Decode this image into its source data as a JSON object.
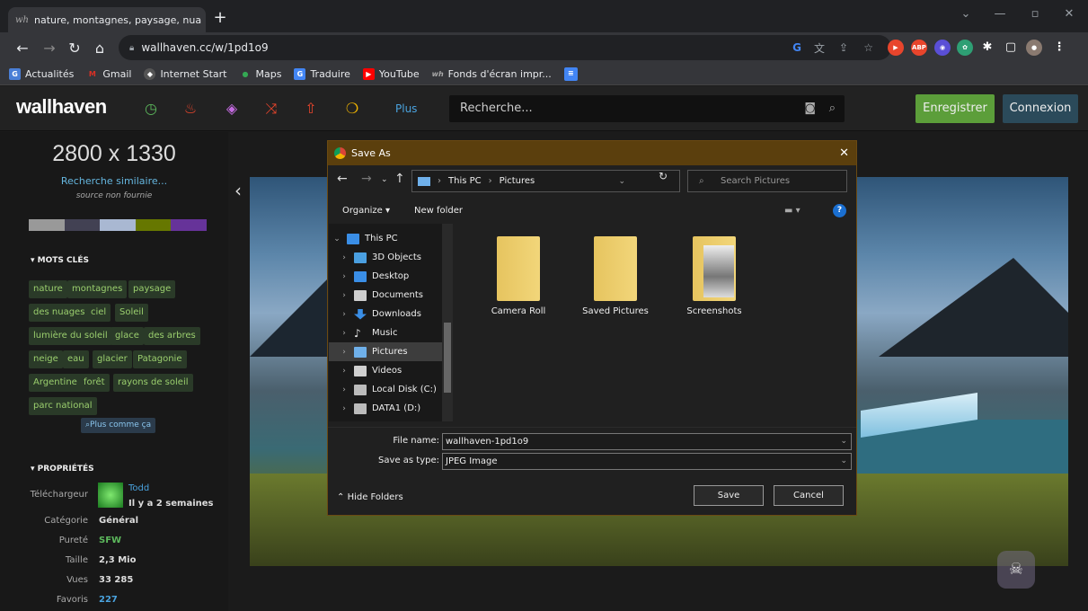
{
  "browser": {
    "tab_title": "nature, montagnes, paysage, nua",
    "tab_favicon": "wh",
    "tab_close": "✕",
    "new_tab": "+",
    "url": "wallhaven.cc/w/1pd1o9",
    "bookmarks": [
      {
        "label": "Actualités",
        "icon": "news-icon",
        "color": "#4a7fd6"
      },
      {
        "label": "Gmail",
        "icon": "gmail-icon",
        "color": "#d93025"
      },
      {
        "label": "Internet Start",
        "icon": "globe-icon",
        "color": "#cccccc"
      },
      {
        "label": "Maps",
        "icon": "maps-icon",
        "color": "#34a853"
      },
      {
        "label": "Traduire",
        "icon": "translate-icon",
        "color": "#4285f4"
      },
      {
        "label": "YouTube",
        "icon": "youtube-icon",
        "color": "#ff0000"
      },
      {
        "label": "Fonds d'écran impr...",
        "icon": "wallhaven-icon",
        "color": "#888888"
      }
    ]
  },
  "site": {
    "logo": "wallhaven",
    "plus": "Plus",
    "search_placeholder": "Recherche...",
    "register": "Enregistrer",
    "login": "Connexion",
    "nav_colors": [
      "#5cb85c",
      "#e8452c",
      "#c46be0",
      "#e8452c",
      "#e8452c",
      "#f0b400"
    ]
  },
  "sidebar": {
    "resolution": "2800 x 1330",
    "similar": "Recherche similaire...",
    "source": "source non fournie",
    "palette": [
      "#999999",
      "#424153",
      "#a9b8d2",
      "#667700",
      "#663399"
    ],
    "tags_heading": "▾ MOTS CLÉS",
    "tags": [
      "nature",
      "montagnes",
      "paysage",
      "des nuages",
      "ciel",
      "Soleil",
      "lumière du soleil",
      "glace",
      "des arbres",
      "neige",
      "eau",
      "glacier",
      "Patagonie",
      "Argentine",
      "forêt",
      "rayons de soleil",
      "parc national"
    ],
    "more": "Plus comme ça",
    "props_heading": "▾ PROPRIÉTÉS",
    "uploader_label": "Téléchargeur",
    "uploader_name": "Todd",
    "uploader_time": "Il y a 2 semaines",
    "props": [
      {
        "label": "Catégorie",
        "value": "Général",
        "color": "#dddddd"
      },
      {
        "label": "Pureté",
        "value": "SFW",
        "color": "#5cb85c"
      },
      {
        "label": "Taille",
        "value": "2,3 Mio",
        "color": "#dddddd"
      },
      {
        "label": "Vues",
        "value": "33 285",
        "color": "#dddddd"
      },
      {
        "label": "Favoris",
        "value": "227",
        "color": "#4aa3df"
      }
    ]
  },
  "dialog": {
    "title": "Save As",
    "close": "✕",
    "path": [
      "This PC",
      "Pictures"
    ],
    "search_placeholder": "Search Pictures",
    "organize": "Organize ▾",
    "new_folder": "New folder",
    "tree": [
      {
        "label": "This PC",
        "icon": "pc-icon",
        "color": "#3a8ee6",
        "expanded": true,
        "selected": false
      },
      {
        "label": "3D Objects",
        "icon": "3d-objects-icon",
        "color": "#4a9fe0",
        "selected": false
      },
      {
        "label": "Desktop",
        "icon": "desktop-icon",
        "color": "#3a8ee6",
        "selected": false
      },
      {
        "label": "Documents",
        "icon": "documents-icon",
        "color": "#cfcfcf",
        "selected": false
      },
      {
        "label": "Downloads",
        "icon": "downloads-icon",
        "color": "#3a8ee6",
        "selected": false
      },
      {
        "label": "Music",
        "icon": "music-icon",
        "color": "#e6e6e6",
        "selected": false
      },
      {
        "label": "Pictures",
        "icon": "pictures-icon",
        "color": "#6fb0ea",
        "selected": true
      },
      {
        "label": "Videos",
        "icon": "videos-icon",
        "color": "#cfcfcf",
        "selected": false
      },
      {
        "label": "Local Disk (C:)",
        "icon": "local-disk-icon",
        "color": "#bbbbbb",
        "selected": false
      },
      {
        "label": "DATA1 (D:)",
        "icon": "drive-icon",
        "color": "#bbbbbb",
        "selected": false
      }
    ],
    "folders": [
      "Camera Roll",
      "Saved Pictures",
      "Screenshots"
    ],
    "file_name_label": "File name:",
    "file_name": "wallhaven-1pd1o9",
    "save_type_label": "Save as type:",
    "save_type": "JPEG Image",
    "hide_folders": "Hide Folders",
    "save": "Save",
    "cancel": "Cancel"
  }
}
